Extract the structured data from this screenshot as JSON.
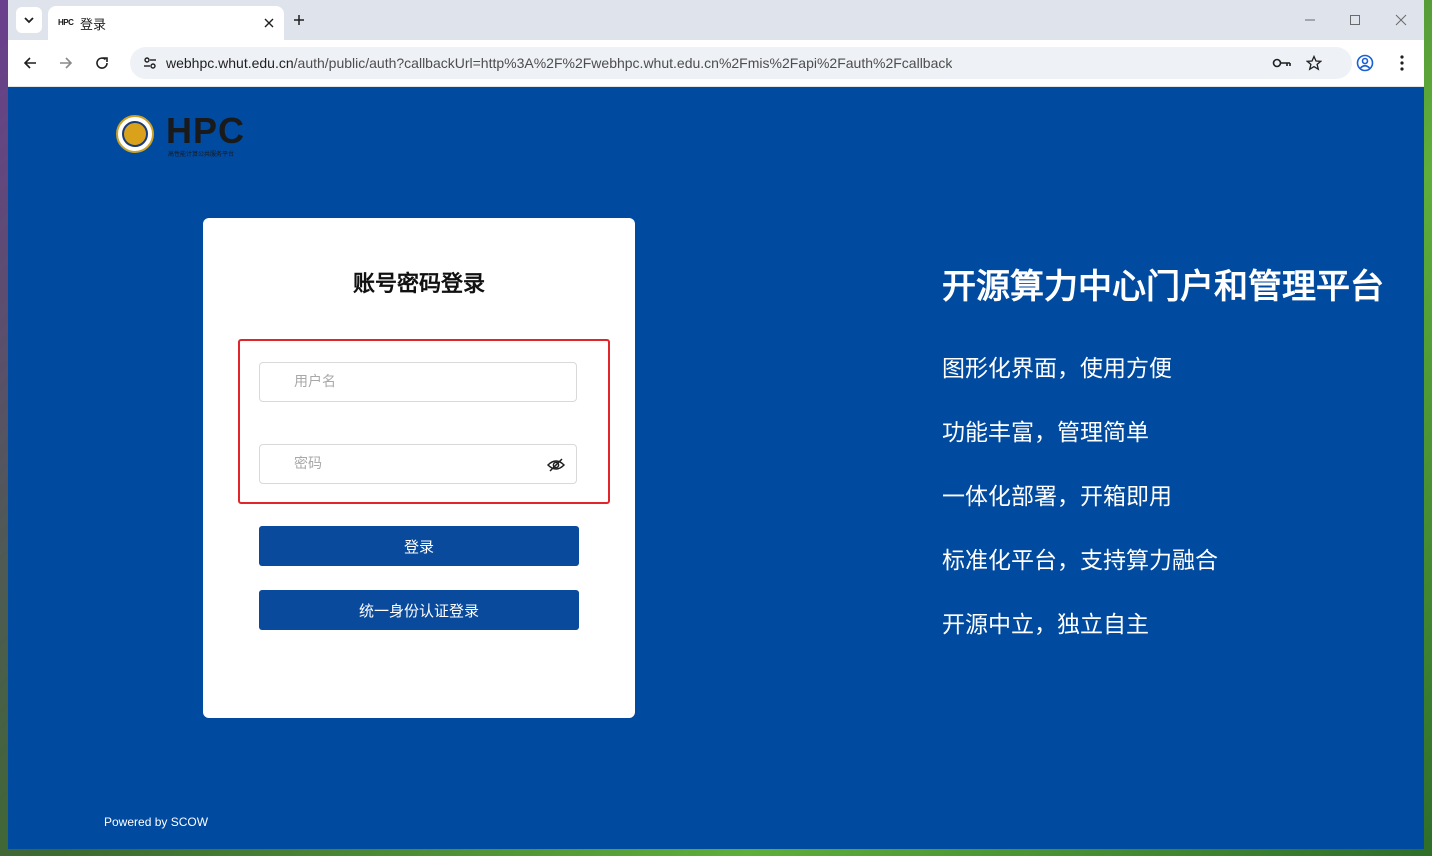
{
  "browser": {
    "tab": {
      "favicon_text": "HPC",
      "title": "登录"
    },
    "url": {
      "host": "webhpc.whut.edu.cn",
      "path": "/auth/public/auth?callbackUrl=http%3A%2F%2Fwebhpc.whut.edu.cn%2Fmis%2Fapi%2Fauth%2Fcallback"
    },
    "icons": [
      "chevron-down-icon",
      "close-icon",
      "plus-icon",
      "minimize-icon",
      "maximize-icon",
      "back-icon",
      "forward-icon",
      "reload-icon",
      "site-info-icon",
      "key-icon",
      "star-icon",
      "profile-icon",
      "more-icon"
    ]
  },
  "logo": {
    "text": "HPC",
    "subtitle": "高性能计算公共服务平台"
  },
  "login": {
    "title": "账号密码登录",
    "username_placeholder": "用户名",
    "password_placeholder": "密码",
    "login_button": "登录",
    "sso_button": "统一身份认证登录"
  },
  "hero": {
    "title": "开源算力中心门户和管理平台",
    "features": [
      "图形化界面，使用方便",
      "功能丰富，管理简单",
      "一体化部署，开箱即用",
      "标准化平台，支持算力融合",
      "开源中立，独立自主"
    ]
  },
  "footer": {
    "powered": "Powered by SCOW"
  },
  "colors": {
    "page_bg": "#004a9f",
    "button": "#0a4a9c",
    "highlight": "#e0262b"
  }
}
